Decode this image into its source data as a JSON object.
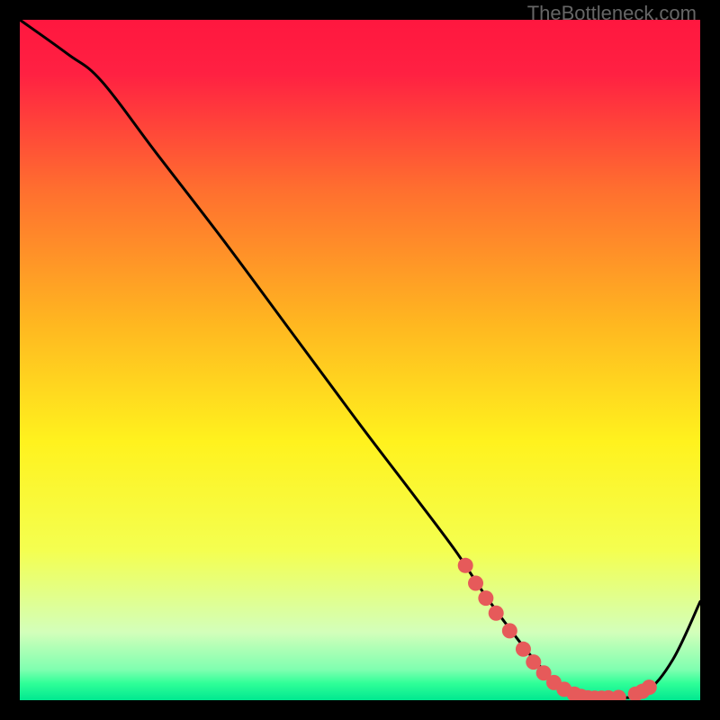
{
  "watermark": "TheBottleneck.com",
  "chart_data": {
    "type": "line",
    "title": "",
    "xlabel": "",
    "ylabel": "",
    "xlim": [
      0,
      100
    ],
    "ylim": [
      0,
      100
    ],
    "gradient_stops": [
      {
        "offset": 0.0,
        "color": "#ff173f"
      },
      {
        "offset": 0.08,
        "color": "#ff2142"
      },
      {
        "offset": 0.25,
        "color": "#ff6f2f"
      },
      {
        "offset": 0.45,
        "color": "#ffb820"
      },
      {
        "offset": 0.62,
        "color": "#fff21e"
      },
      {
        "offset": 0.78,
        "color": "#f4ff50"
      },
      {
        "offset": 0.9,
        "color": "#d3ffba"
      },
      {
        "offset": 0.955,
        "color": "#7fffb0"
      },
      {
        "offset": 0.975,
        "color": "#30ff98"
      },
      {
        "offset": 1.0,
        "color": "#00e890"
      }
    ],
    "series": [
      {
        "name": "curve",
        "x": [
          0,
          7,
          12,
          20,
          30,
          40,
          50,
          58,
          64,
          68,
          72,
          76,
          80,
          84,
          88,
          92,
          96,
          100
        ],
        "y": [
          100,
          95,
          91,
          80.5,
          67.5,
          54,
          40.5,
          30,
          22,
          16,
          10.5,
          5.5,
          1.6,
          0.3,
          0.3,
          1.2,
          6,
          14.5
        ]
      }
    ],
    "markers": {
      "name": "dots",
      "color": "#e65a5a",
      "x": [
        65.5,
        67,
        68.5,
        70,
        72,
        74,
        75.5,
        77,
        78.5,
        80,
        81.5,
        82.5,
        83.5,
        84.5,
        85.5,
        86.5,
        88,
        90.5,
        91.5,
        92.5
      ],
      "y": [
        19.8,
        17.2,
        15.0,
        12.8,
        10.2,
        7.5,
        5.6,
        4.0,
        2.6,
        1.6,
        0.9,
        0.55,
        0.35,
        0.3,
        0.3,
        0.35,
        0.4,
        0.9,
        1.3,
        1.9
      ]
    }
  }
}
